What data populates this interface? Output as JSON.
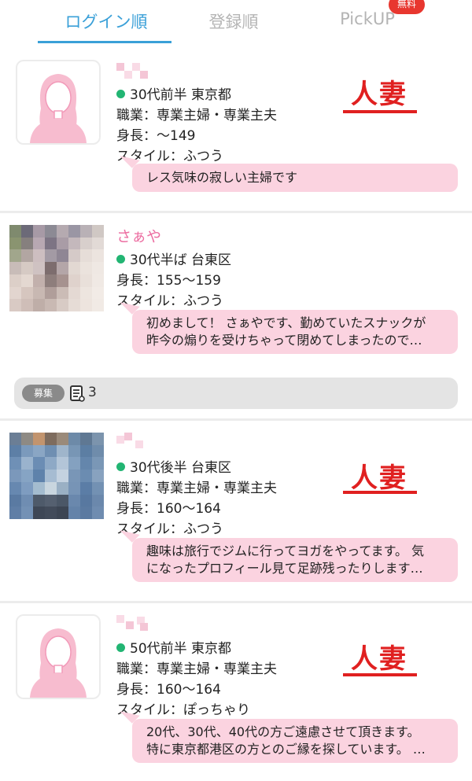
{
  "tabs": {
    "items": [
      {
        "label": "ログイン順",
        "active": true
      },
      {
        "label": "登録順",
        "active": false
      },
      {
        "label": "PickUP",
        "active": false
      }
    ],
    "pickup_badge": "無料"
  },
  "colors": {
    "accent": "#3aa0d8",
    "online_dot": "#22b573",
    "bubble": "#fbd3e0",
    "name_pink": "#ec6ea1",
    "tag_red": "#e02020"
  },
  "profiles": [
    {
      "name": "",
      "avatar": "female-silhouette-icon",
      "age_area": "30代前半 東京都",
      "job": "職業：専業主婦・専業主夫",
      "height": "身長：〜149",
      "style": "スタイル：ふつう",
      "message": [
        "レス気味の寂しい主婦です"
      ],
      "tag": "人妻"
    },
    {
      "name": "さぁや",
      "avatar": "blurred-photo",
      "age_area": "30代半ば 台東区",
      "height": "身長：155〜159",
      "style": "スタイル：ふつう",
      "message": [
        "初めまして！ さぁやです、勤めていたスナックが",
        "昨今の煽りを受けちゃって閉めてしまったので…"
      ]
    },
    {
      "name": "",
      "avatar": "blurred-photo",
      "age_area": "30代後半 台東区",
      "job": "職業：専業主婦・専業主夫",
      "height": "身長：160〜164",
      "style": "スタイル：ふつう",
      "message": [
        "趣味は旅行でジムに行ってヨガをやってます。 気",
        "になったプロフィール見て足跡残ったりします…"
      ],
      "tag": "人妻"
    },
    {
      "name": "",
      "avatar": "female-silhouette-icon",
      "age_area": "50代前半 東京都",
      "job": "職業：専業主婦・専業主夫",
      "height": "身長：160〜164",
      "style": "スタイル：ぽっちゃり",
      "message": [
        "20代、30代、40代の方ご遠慮させて頂きます。",
        "特に東京都港区の方とのご縁を探しています。 …"
      ],
      "tag": "人妻"
    }
  ],
  "recruit": {
    "label": "募集",
    "icon": "board-list-icon",
    "count": "3"
  }
}
